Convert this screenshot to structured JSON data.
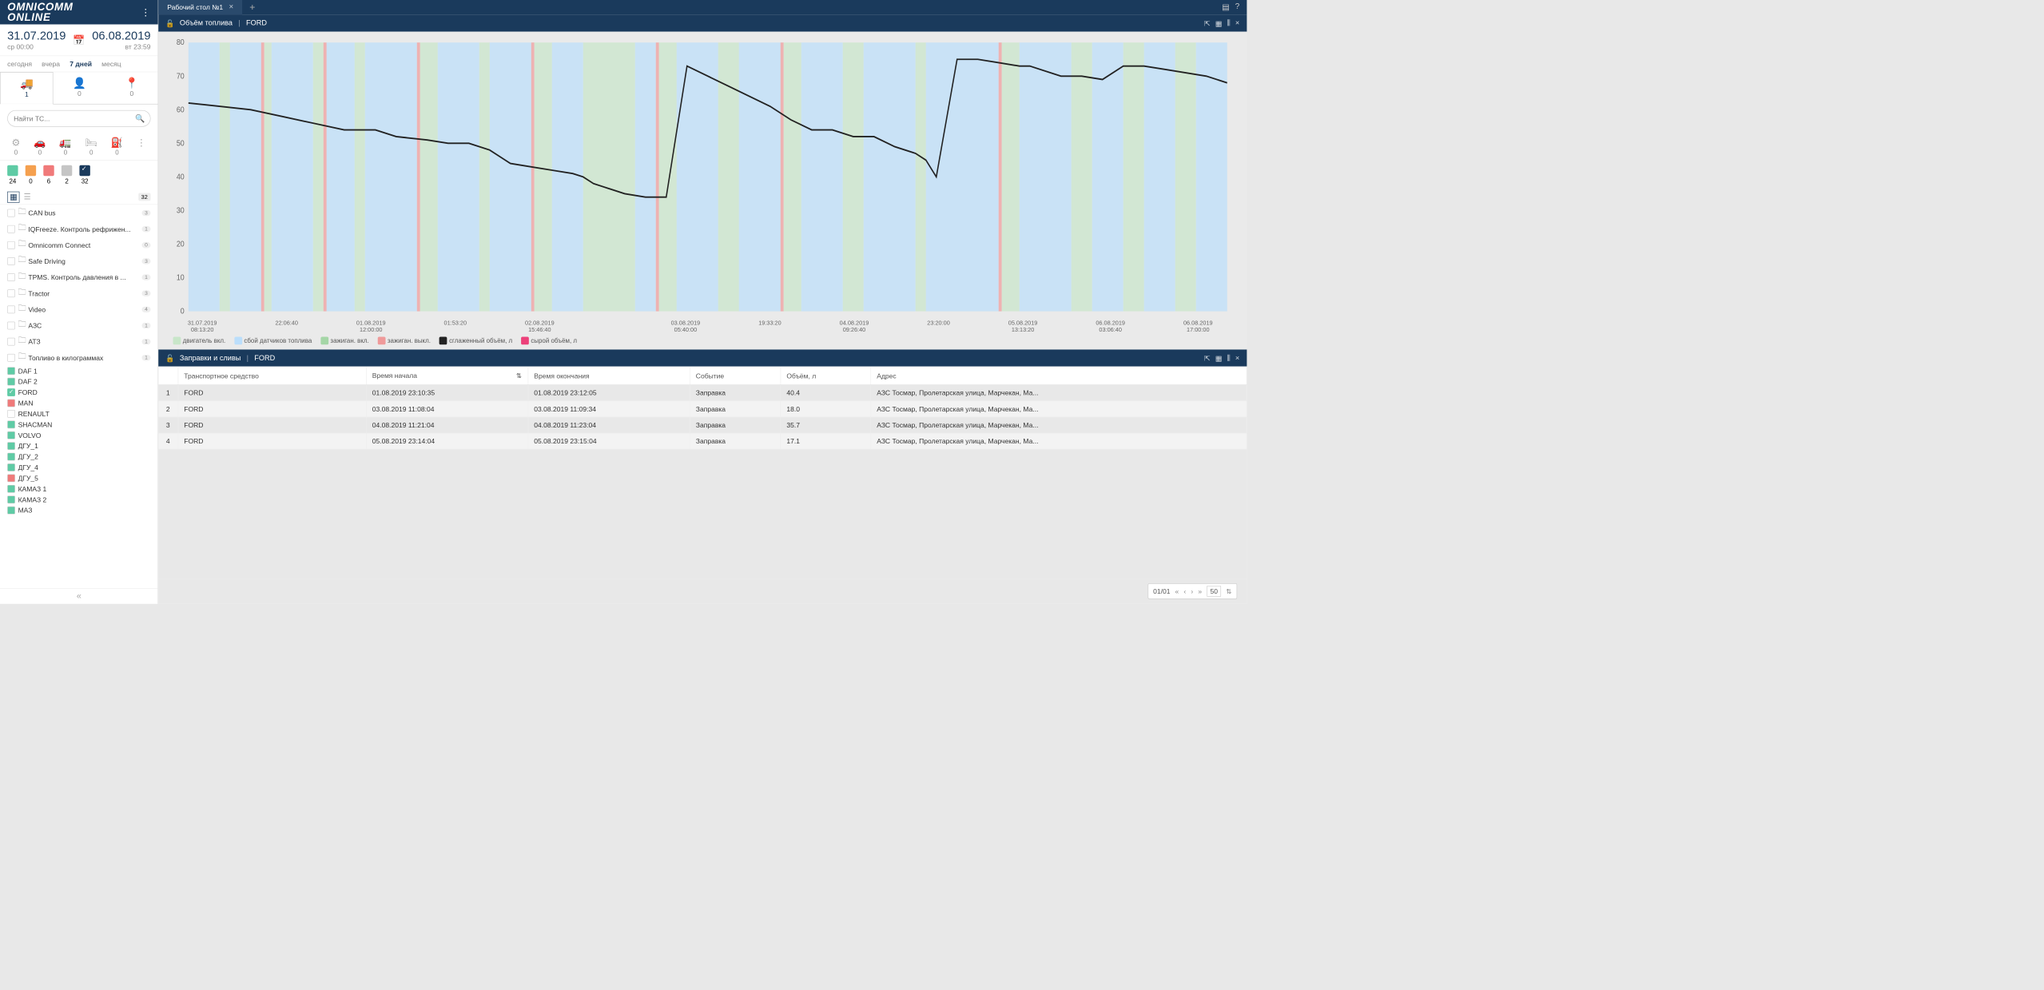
{
  "logo": "OMNICOMM\nONLINE",
  "dateRange": {
    "from": {
      "date": "31.07.2019",
      "sub": "ср 00:00"
    },
    "to": {
      "date": "06.08.2019",
      "sub": "вт 23:59"
    }
  },
  "quick": {
    "today": "сегодня",
    "yesterday": "вчера",
    "week": "7 дней",
    "month": "месяц"
  },
  "entityTabs": [
    {
      "icon": "🚚",
      "count": "1"
    },
    {
      "icon": "👤",
      "count": "0"
    },
    {
      "icon": "📍",
      "count": "0"
    }
  ],
  "search": {
    "placeholder": "Найти ТС..."
  },
  "filterIcons": [
    {
      "icon": "⚙",
      "count": "0"
    },
    {
      "icon": "🚗",
      "count": "0"
    },
    {
      "icon": "🚛",
      "count": "0"
    },
    {
      "icon": "🛏",
      "count": "0"
    },
    {
      "icon": "⛽",
      "count": "0"
    }
  ],
  "colorFilters": [
    {
      "cls": "cf-green",
      "count": "24"
    },
    {
      "cls": "cf-orange",
      "count": "0"
    },
    {
      "cls": "cf-red",
      "count": "6"
    },
    {
      "cls": "cf-gray",
      "count": "2"
    },
    {
      "cls": "cf-dark",
      "count": "32"
    }
  ],
  "treeTotal": "32",
  "tree": [
    {
      "type": "folder",
      "label": "CAN bus",
      "badge": "3"
    },
    {
      "type": "folder",
      "label": "IQFreeze. Контроль рефрижен...",
      "badge": "1"
    },
    {
      "type": "folder",
      "label": "Omnicomm Connect",
      "badge": "0"
    },
    {
      "type": "folder",
      "label": "Safe Driving",
      "badge": "3"
    },
    {
      "type": "folder",
      "label": "TPMS. Контроль давления в ...",
      "badge": "1"
    },
    {
      "type": "folder",
      "label": "Tractor",
      "badge": "3"
    },
    {
      "type": "folder",
      "label": "Video",
      "badge": "4"
    },
    {
      "type": "folder",
      "label": "АЗС",
      "badge": "1"
    },
    {
      "type": "folder",
      "label": "АТЗ",
      "badge": "1"
    },
    {
      "type": "folder",
      "label": "Топливо в килограммах",
      "badge": "1"
    },
    {
      "type": "vehicle",
      "label": "DAF 1",
      "color": "#5fcba5"
    },
    {
      "type": "vehicle",
      "label": "DAF 2",
      "color": "#5fcba5"
    },
    {
      "type": "vehicle",
      "label": "FORD",
      "color": "#5fcba5",
      "selected": true
    },
    {
      "type": "vehicle",
      "label": "MAN",
      "color": "#f07a7a"
    },
    {
      "type": "vehicle",
      "label": "RENAULT",
      "color": "#ffffff"
    },
    {
      "type": "vehicle",
      "label": "SHACMAN",
      "color": "#5fcba5"
    },
    {
      "type": "vehicle",
      "label": "VOLVO",
      "color": "#5fcba5"
    },
    {
      "type": "vehicle",
      "label": "ДГУ_1",
      "color": "#5fcba5"
    },
    {
      "type": "vehicle",
      "label": "ДГУ_2",
      "color": "#5fcba5"
    },
    {
      "type": "vehicle",
      "label": "ДГУ_4",
      "color": "#5fcba5"
    },
    {
      "type": "vehicle",
      "label": "ДГУ_5",
      "color": "#f07a7a"
    },
    {
      "type": "vehicle",
      "label": "КАМАЗ 1",
      "color": "#5fcba5"
    },
    {
      "type": "vehicle",
      "label": "КАМАЗ 2",
      "color": "#5fcba5"
    },
    {
      "type": "vehicle",
      "label": "МАЗ",
      "color": "#5fcba5"
    }
  ],
  "tabs": {
    "tab1": "Рабочий стол №1"
  },
  "panel1": {
    "title": "Объём топлива",
    "vehicle": "FORD"
  },
  "legend": [
    {
      "color": "#c8e6c9",
      "label": "двигатель вкл."
    },
    {
      "color": "#bbdefb",
      "label": "сбой датчиков топлива"
    },
    {
      "color": "#a5d6a7",
      "label": "зажиган. вкл."
    },
    {
      "color": "#ef9a9a",
      "label": "зажиган. выкл."
    },
    {
      "color": "#222222",
      "label": "сглаженный объём, л"
    },
    {
      "color": "#ec407a",
      "label": "сырой объём, л"
    }
  ],
  "chart_data": {
    "type": "line",
    "title": "Объём топлива — FORD",
    "ylabel": "",
    "xlabel": "",
    "ylim": [
      0,
      80
    ],
    "y_ticks": [
      0,
      10,
      20,
      30,
      40,
      50,
      60,
      70,
      80
    ],
    "x_ticks": [
      {
        "top": "31.07.2019",
        "bot": "08:13:20"
      },
      {
        "top": "",
        "bot": "22:06:40"
      },
      {
        "top": "01.08.2019",
        "bot": "12:00:00"
      },
      {
        "top": "",
        "bot": "01:53:20"
      },
      {
        "top": "02.08.2019",
        "bot": "15:46:40"
      },
      {
        "top": "",
        "bot": ""
      },
      {
        "top": "03.08.2019",
        "bot": "05:40:00"
      },
      {
        "top": "",
        "bot": "19:33:20"
      },
      {
        "top": "04.08.2019",
        "bot": "09:26:40"
      },
      {
        "top": "",
        "bot": "23:20:00"
      },
      {
        "top": "05.08.2019",
        "bot": "13:13:20"
      },
      {
        "top": "06.08.2019",
        "bot": "03:06:40"
      },
      {
        "top": "06.08.2019",
        "bot": "17:00:00"
      }
    ],
    "series": [
      {
        "name": "сглаженный объём, л",
        "x_pct": [
          0,
          3,
          6,
          9,
          12,
          15,
          18,
          20,
          23,
          25,
          27,
          29,
          30,
          31,
          33,
          35,
          37,
          38,
          39,
          40,
          42,
          44,
          46,
          48,
          50,
          52,
          54,
          56,
          58,
          60,
          62,
          64,
          66,
          68,
          70,
          71,
          72,
          74,
          76,
          78,
          80,
          81,
          82,
          84,
          86,
          88,
          90,
          92,
          94,
          96,
          98,
          100
        ],
        "y": [
          62,
          61,
          60,
          58,
          56,
          54,
          54,
          52,
          51,
          50,
          50,
          48,
          46,
          44,
          43,
          42,
          41,
          40,
          38,
          37,
          35,
          34,
          34,
          73,
          70,
          67,
          64,
          61,
          57,
          54,
          54,
          52,
          52,
          49,
          47,
          45,
          40,
          75,
          75,
          74,
          73,
          73,
          72,
          70,
          70,
          69,
          73,
          73,
          72,
          71,
          70,
          68
        ]
      }
    ]
  },
  "panel2": {
    "title": "Заправки и сливы",
    "vehicle": "FORD"
  },
  "table": {
    "headers": [
      "",
      "Транспортное средство",
      "Время начала",
      "Время окончания",
      "Событие",
      "Объём, л",
      "Адрес"
    ],
    "rows": [
      [
        "1",
        "FORD",
        "01.08.2019 23:10:35",
        "01.08.2019 23:12:05",
        "Заправка",
        "40.4",
        "АЗС Тосмар, Пролетарская улица, Марчекан, Ма..."
      ],
      [
        "2",
        "FORD",
        "03.08.2019 11:08:04",
        "03.08.2019 11:09:34",
        "Заправка",
        "18.0",
        "АЗС Тосмар, Пролетарская улица, Марчекан, Ма..."
      ],
      [
        "3",
        "FORD",
        "04.08.2019 11:21:04",
        "04.08.2019 11:23:04",
        "Заправка",
        "35.7",
        "АЗС Тосмар, Пролетарская улица, Марчекан, Ма..."
      ],
      [
        "4",
        "FORD",
        "05.08.2019 23:14:04",
        "05.08.2019 23:15:04",
        "Заправка",
        "17.1",
        "АЗС Тосмар, Пролетарская улица, Марчекан, Ма..."
      ]
    ]
  },
  "pager": {
    "page": "01/01",
    "size": "50"
  }
}
